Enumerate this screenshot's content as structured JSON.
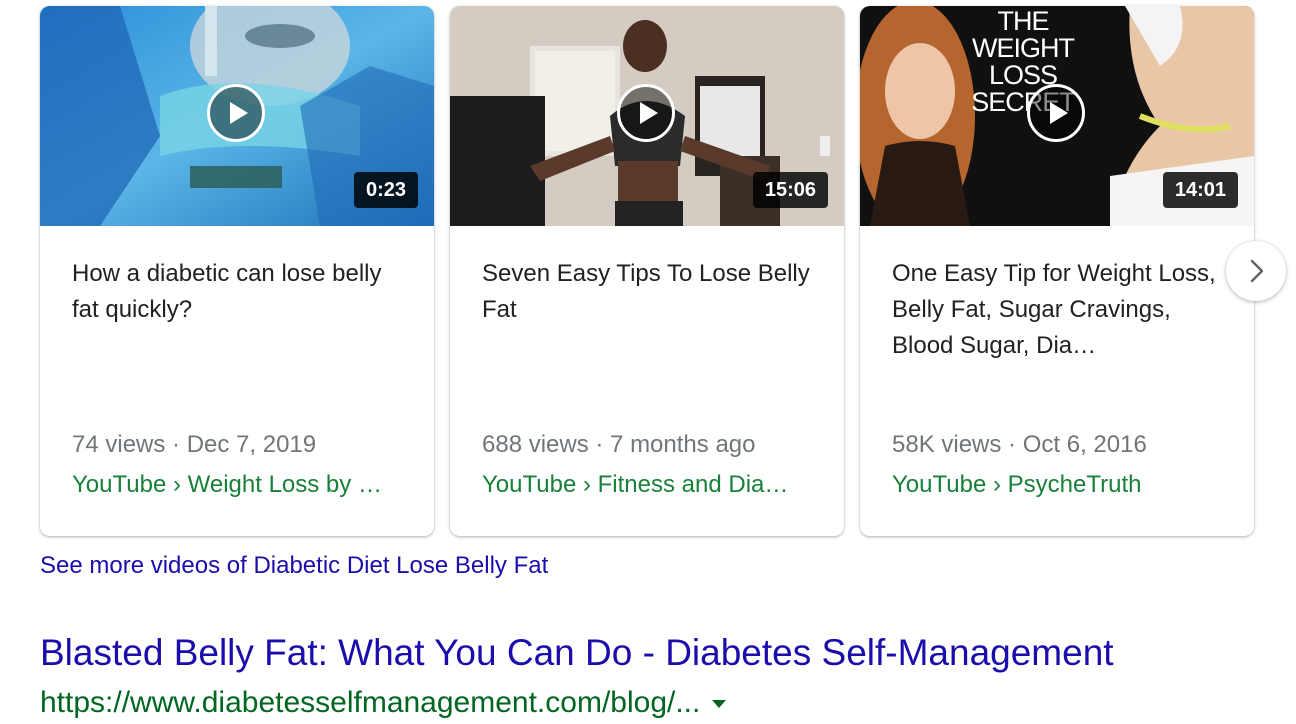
{
  "videos": [
    {
      "title": "How a diabetic can lose belly fat quickly?",
      "duration": "0:23",
      "meta": "74 views · Dec 7, 2019",
      "source": "YouTube › Weight Loss by …"
    },
    {
      "title": "Seven Easy Tips To Lose Belly Fat",
      "duration": "15:06",
      "meta": "688 views · 7 months ago",
      "source": "YouTube › Fitness and Dia…"
    },
    {
      "title": "One Easy Tip for Weight Loss, Belly Fat, Sugar Cravings, Blood Sugar, Dia…",
      "duration": "14:01",
      "meta": "58K views · Oct 6, 2016",
      "source": "YouTube › PsycheTruth",
      "thumb_caption": "THE WEIGHT LOSS SECRET"
    }
  ],
  "see_more": "See more videos of Diabetic Diet Lose Belly Fat",
  "result": {
    "title": "Blasted Belly Fat: What You Can Do - Diabetes Self-Management",
    "url": "https://www.diabetesselfmanagement.com/blog/..."
  },
  "icons": {
    "next": "chevron-right-icon",
    "play": "play-icon",
    "url_menu": "caret-down-icon"
  },
  "colors": {
    "link": "#1a0dab",
    "source_green": "#188038",
    "url_green": "#006621",
    "meta_gray": "#70757a"
  }
}
